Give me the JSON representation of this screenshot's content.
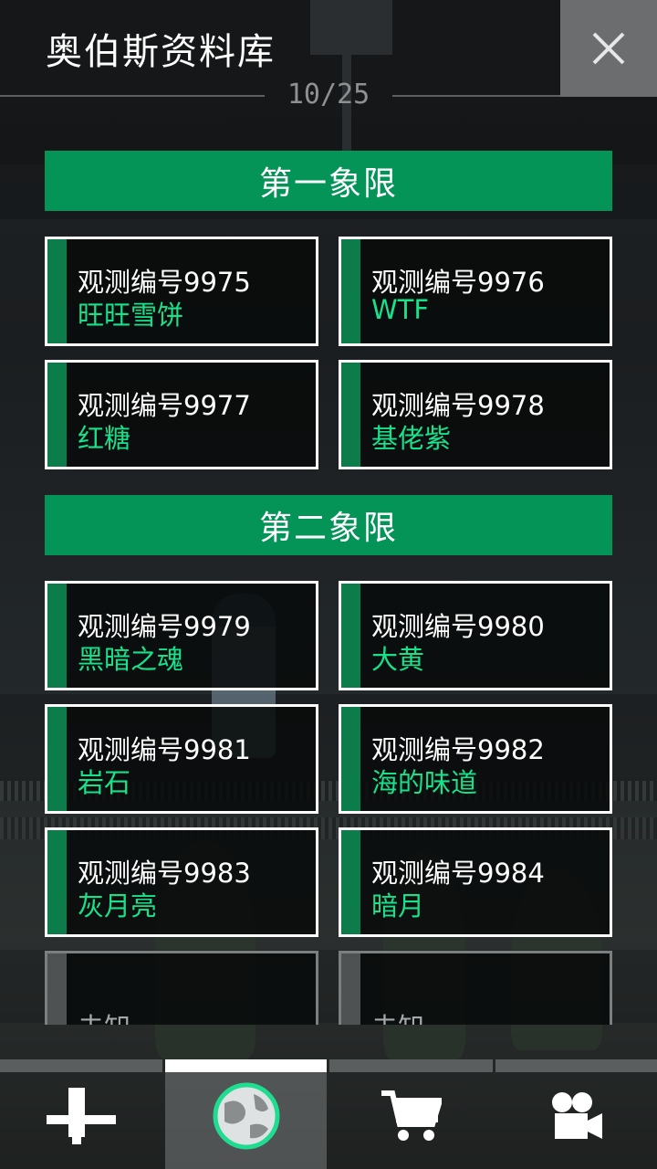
{
  "header": {
    "title": "奥伯斯资料库",
    "page_indicator": "10/25"
  },
  "sections": [
    {
      "title": "第一象限",
      "cards": [
        {
          "code": "观测编号9975",
          "name": "旺旺雪饼"
        },
        {
          "code": "观测编号9976",
          "name": "WTF"
        },
        {
          "code": "观测编号9977",
          "name": "红糖"
        },
        {
          "code": "观测编号9978",
          "name": "基佬紫"
        }
      ]
    },
    {
      "title": "第二象限",
      "cards": [
        {
          "code": "观测编号9979",
          "name": "黑暗之魂"
        },
        {
          "code": "观测编号9980",
          "name": "大黄"
        },
        {
          "code": "观测编号9981",
          "name": "岩石"
        },
        {
          "code": "观测编号9982",
          "name": "海的味道"
        },
        {
          "code": "观测编号9983",
          "name": "灰月亮"
        },
        {
          "code": "观测编号9984",
          "name": "暗月"
        },
        {
          "code": "",
          "name": "未知"
        },
        {
          "code": "",
          "name": "未知"
        }
      ]
    }
  ],
  "tabs": [
    {
      "icon": "telescope-icon",
      "active": false
    },
    {
      "icon": "planet-icon",
      "active": true
    },
    {
      "icon": "cart-icon",
      "active": false
    },
    {
      "icon": "video-camera-icon",
      "active": false
    }
  ],
  "colors": {
    "accent": "#049458",
    "name_text": "#18e18c",
    "card_stripe": "#0c7c4b"
  }
}
